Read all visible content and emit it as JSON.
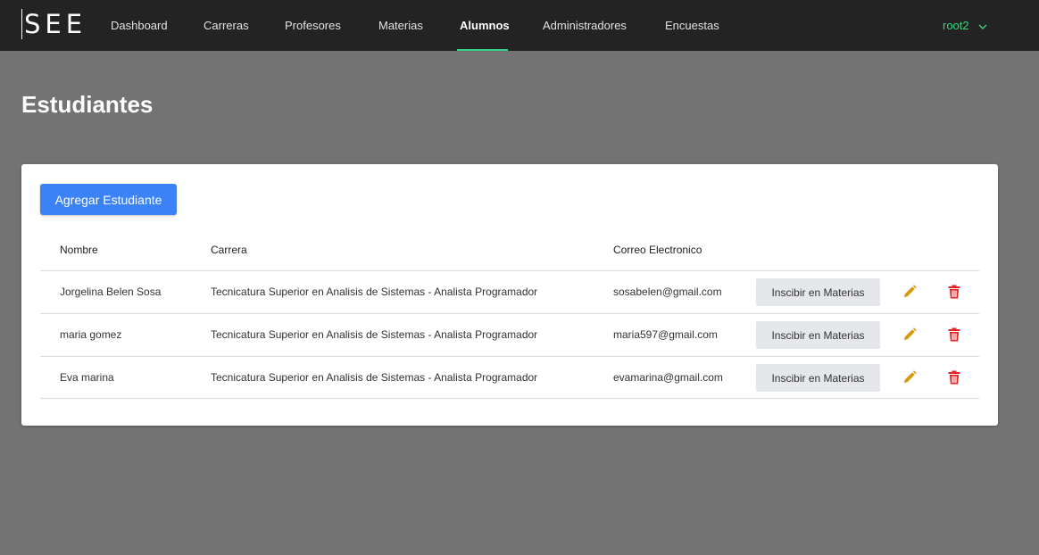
{
  "app": {
    "logo": "SEE"
  },
  "nav": {
    "items": [
      {
        "label": "Dashboard"
      },
      {
        "label": "Carreras"
      },
      {
        "label": "Profesores"
      },
      {
        "label": "Materias"
      },
      {
        "label": "Alumnos",
        "active": true
      },
      {
        "label": "Administradores"
      },
      {
        "label": "Encuestas"
      }
    ],
    "user": {
      "label": "root2",
      "icon": "chevron-down-icon"
    }
  },
  "page": {
    "title": "Estudiantes"
  },
  "toolbar": {
    "add_label": "Agregar Estudiante"
  },
  "table": {
    "columns": [
      "Nombre",
      "Carrera",
      "Correo Electronico"
    ],
    "rows": [
      {
        "name": "Jorgelina Belen Sosa",
        "career": "Tecnicatura Superior en Analisis de Sistemas - Analista Programador",
        "email": "sosabelen@gmail.com",
        "action": "Inscibir en Materias"
      },
      {
        "name": "maria gomez",
        "career": "Tecnicatura Superior en Analisis de Sistemas - Analista Programador",
        "email": "maria597@gmail.com",
        "action": "Inscibir en Materias"
      },
      {
        "name": "Eva marina",
        "career": "Tecnicatura Superior en Analisis de Sistemas - Analista Programador",
        "email": "evamarina@gmail.com",
        "action": "Inscibir en Materias"
      }
    ],
    "row_icons": [
      "pencil-icon",
      "trash-icon"
    ]
  },
  "colors": {
    "topbar": "#232323",
    "background": "#737373",
    "accent_green": "#36d67a",
    "primary_blue": "#3b82f6",
    "edit_orange": "#d89a0d",
    "delete_red": "#dc2626"
  }
}
